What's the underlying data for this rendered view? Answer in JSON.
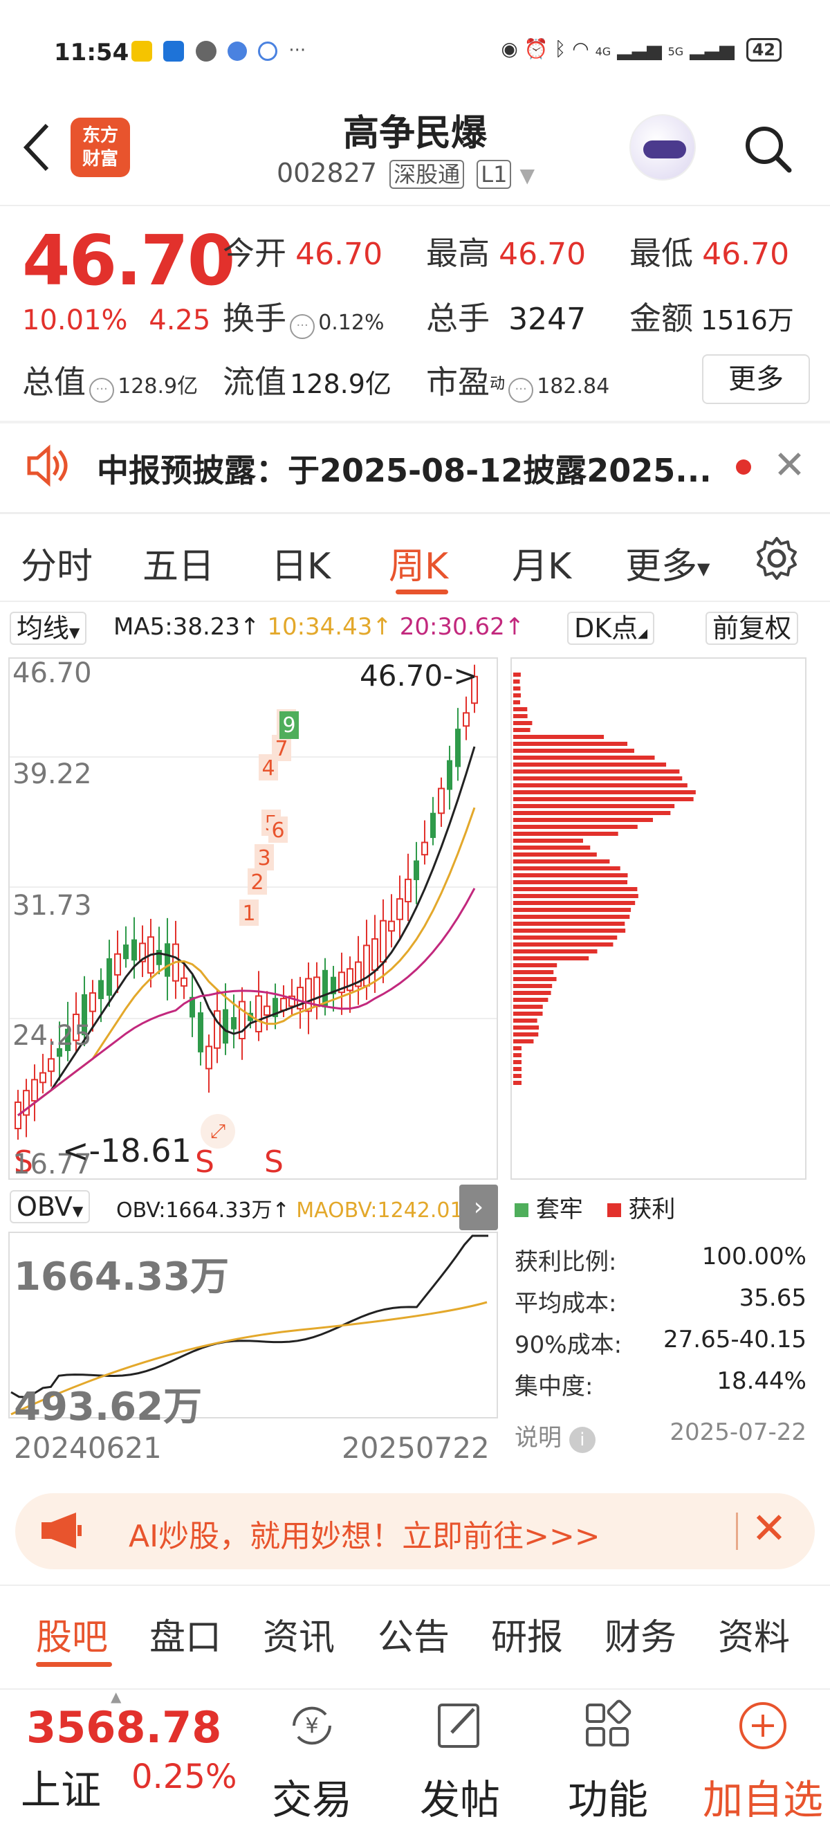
{
  "status_bar": {
    "time": "11:54",
    "battery": "42",
    "network": "4G",
    "network2": "5G"
  },
  "header": {
    "logo_line1": "东方",
    "logo_line2": "财富",
    "stock_name": "高争民爆",
    "stock_code": "002827",
    "tag_connect": "深股通",
    "tag_level": "L1"
  },
  "quote": {
    "price": "46.70",
    "change_pct": "10.01%",
    "change_amt": "4.25",
    "open_label": "今开",
    "open": "46.70",
    "high_label": "最高",
    "high": "46.70",
    "low_label": "最低",
    "low": "46.70",
    "turnover_label": "换手",
    "turnover": "0.12%",
    "volume_label": "总手",
    "volume": "3247",
    "amount_label": "金额",
    "amount": "1516万",
    "mktcap_label": "总值",
    "mktcap": "128.9亿",
    "float_label": "流值",
    "float": "128.9亿",
    "pe_label": "市盈",
    "pe_sup": "动",
    "pe": "182.84",
    "more_button": "更多"
  },
  "notice": {
    "text": "中报预披露：于2025-08-12披露2025..."
  },
  "chart_tabs": [
    {
      "label": "分时"
    },
    {
      "label": "五日"
    },
    {
      "label": "日K"
    },
    {
      "label": "周K"
    },
    {
      "label": "月K"
    },
    {
      "label": "更多"
    }
  ],
  "ma_bar": {
    "selector": "均线",
    "ma5": "MA5:38.23↑",
    "ma10": "10:34.43↑",
    "ma20": "20:30.62↑",
    "dk_button": "DK点",
    "adjust_button": "前复权"
  },
  "kline": {
    "y_ticks": [
      "46.70",
      "39.22",
      "31.73",
      "24.25",
      "16.77"
    ],
    "high_marker": "46.70->",
    "low_marker": "<-18.61",
    "signal_labels": [
      "1",
      "2",
      "3",
      "4",
      "5",
      "6",
      "7",
      "8"
    ],
    "signal_9": "9",
    "s_labels": [
      "S",
      "S",
      "S"
    ],
    "colors": {
      "up": "#e2312c",
      "down": "#2f9a4a",
      "ma5": "#222222",
      "ma10": "#e3a82b",
      "ma20": "#c2287d"
    }
  },
  "chip": {
    "legend_trapped": "套牢",
    "legend_profit": "获利",
    "stats": [
      {
        "label": "获利比例:",
        "value": "100.00%"
      },
      {
        "label": "平均成本:",
        "value": "35.65"
      },
      {
        "label": "90%成本:",
        "value": "27.65-40.15"
      },
      {
        "label": "集中度:",
        "value": "18.44%"
      }
    ],
    "explain": "说明",
    "date": "2025-07-22"
  },
  "obv": {
    "selector": "OBV",
    "obv": "OBV:1664.33万↑",
    "maobv": "MAOBV:1242.01万↑",
    "top": "1664.33万",
    "bottom": "493.62万",
    "date_start": "20240621",
    "date_end": "20250722"
  },
  "ai_banner": {
    "text": "AI炒股，就用妙想！立即前往>>>"
  },
  "bottom_tabs": [
    {
      "label": "股吧"
    },
    {
      "label": "盘口"
    },
    {
      "label": "资讯"
    },
    {
      "label": "公告"
    },
    {
      "label": "研报"
    },
    {
      "label": "财务"
    },
    {
      "label": "资料"
    }
  ],
  "nav": {
    "index_value": "3568.78",
    "index_name": "上证",
    "index_pct": "0.25%",
    "items": [
      {
        "label": "交易"
      },
      {
        "label": "发帖"
      },
      {
        "label": "功能"
      },
      {
        "label": "加自选"
      }
    ]
  }
}
